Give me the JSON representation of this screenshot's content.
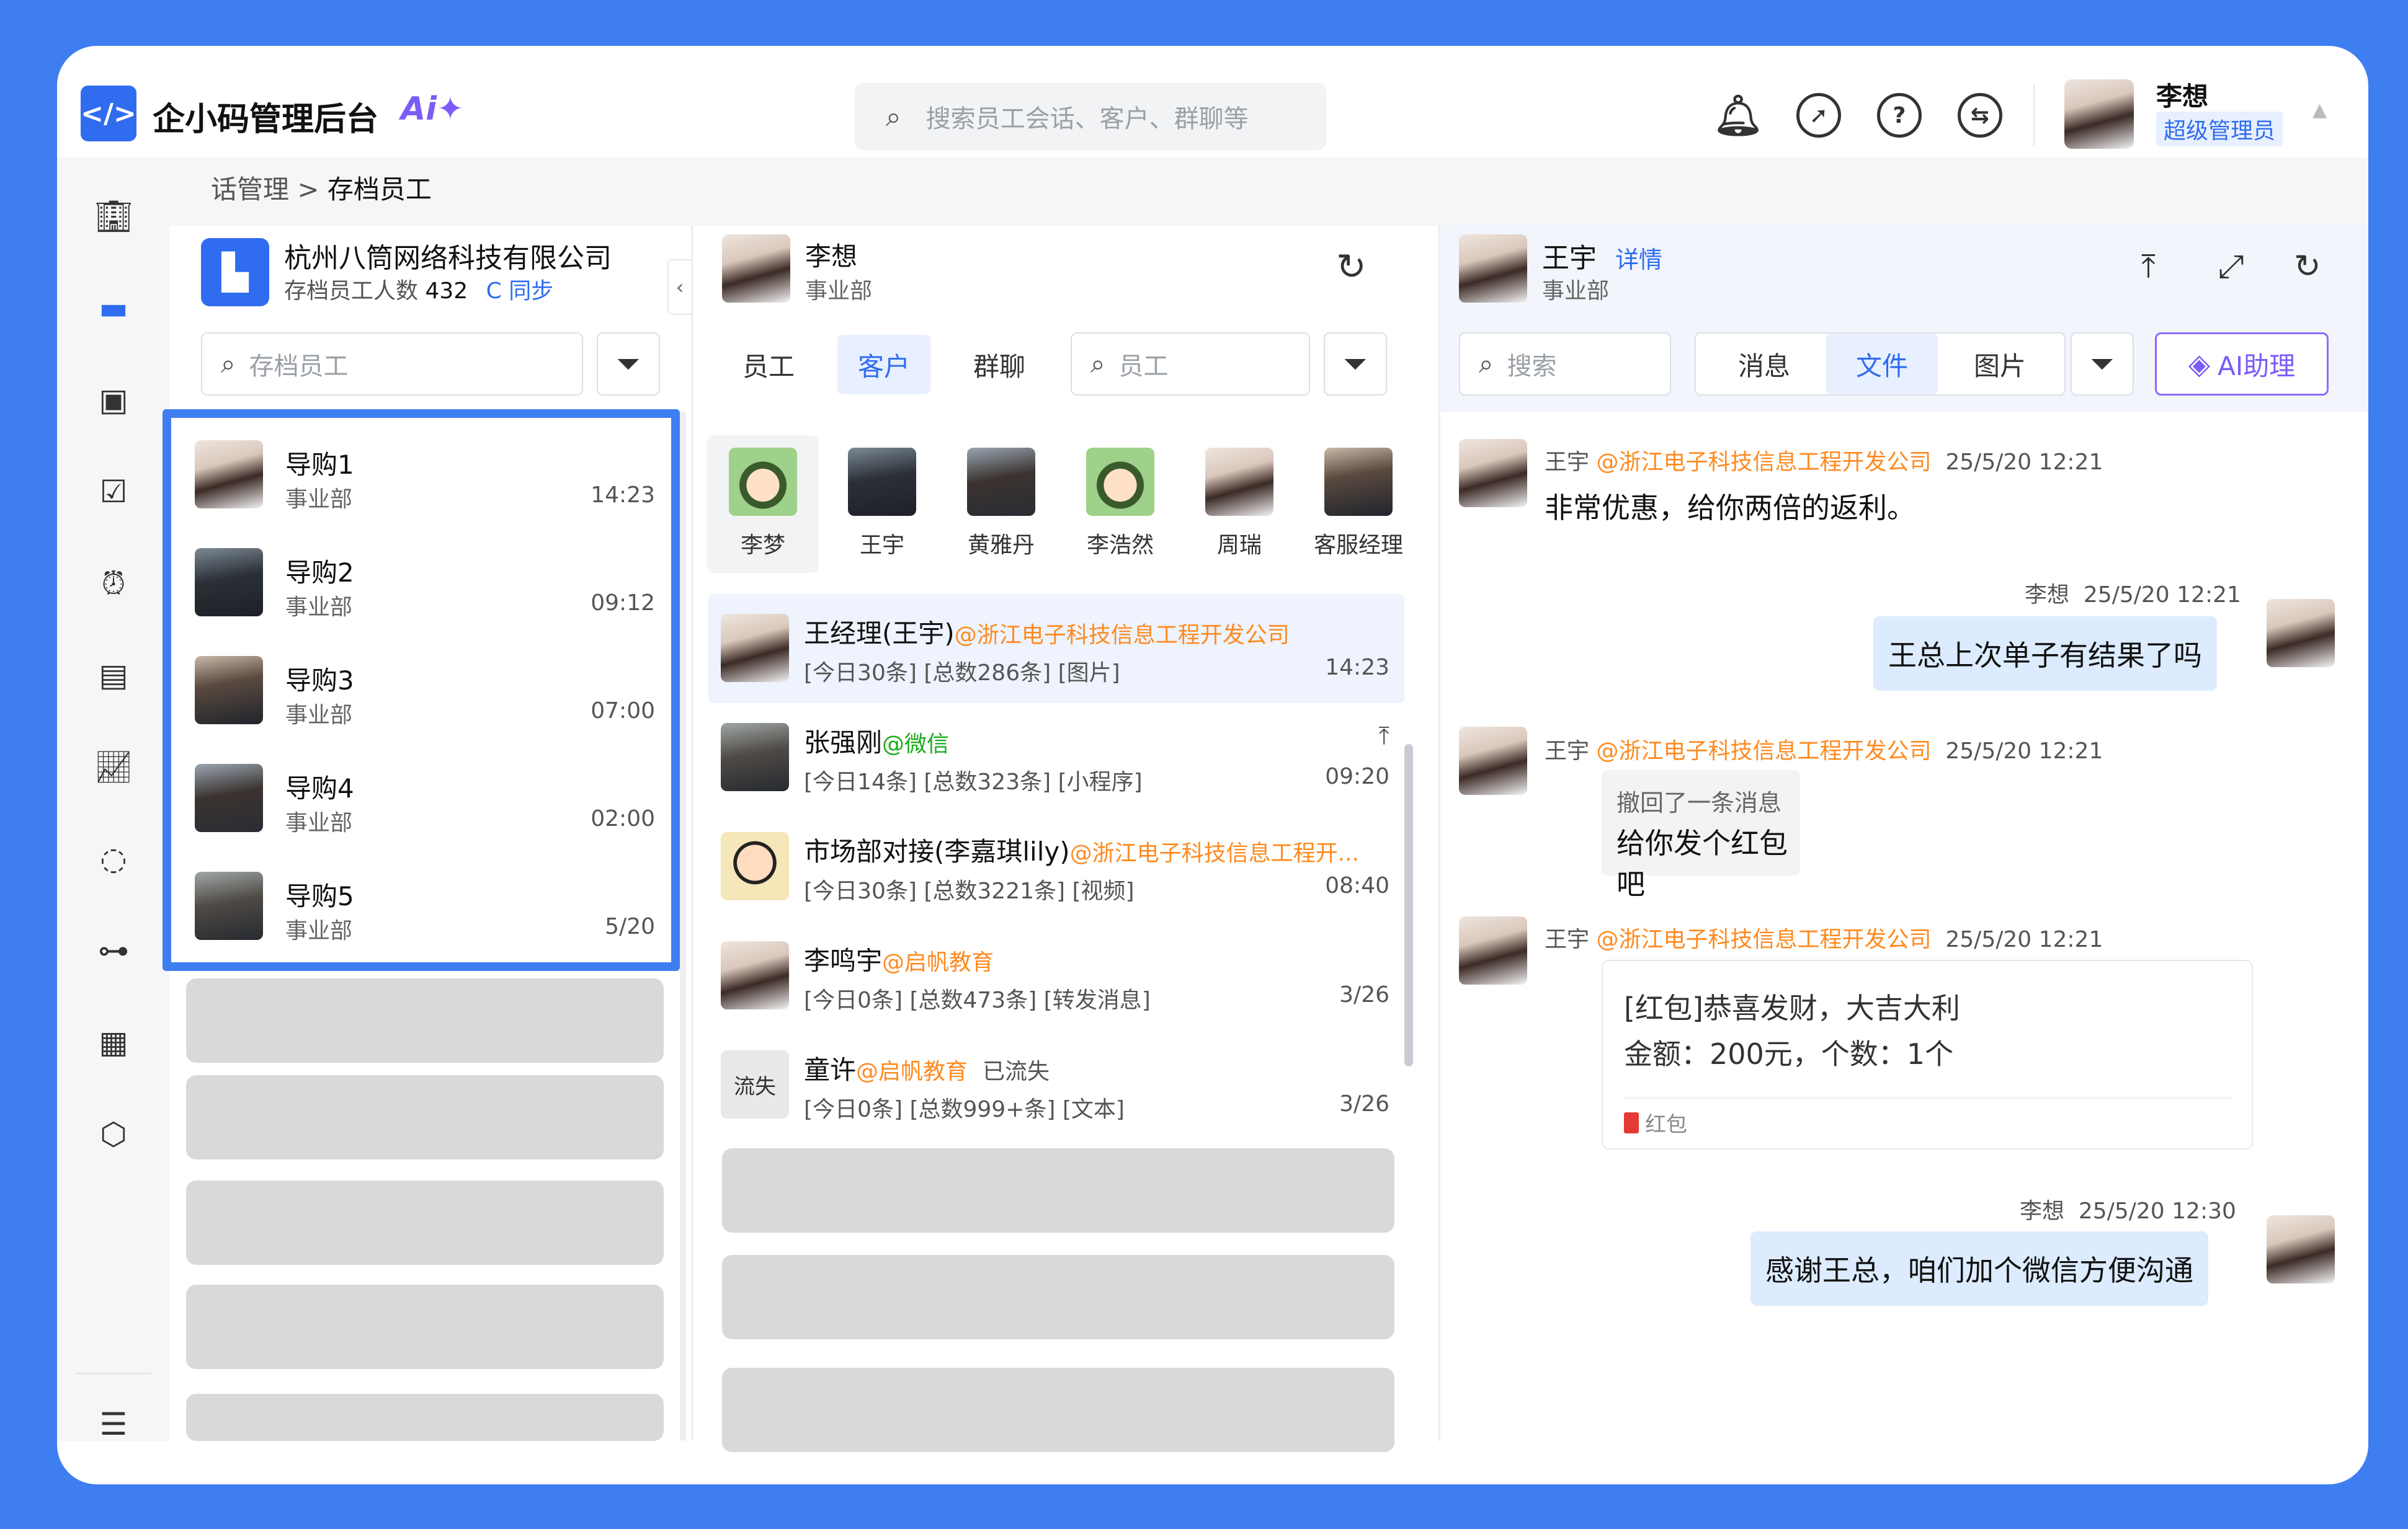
{
  "app": {
    "title": "企小码管理后台",
    "ai_mark": "Ai✦",
    "logo_glyph": "</>"
  },
  "search": {
    "placeholder": "搜索员工会话、客户、群聊等"
  },
  "user": {
    "name": "李想",
    "role": "超级管理员"
  },
  "breadcrumb": {
    "parent": "话管理",
    "current": "存档员工"
  },
  "org": {
    "name": "杭州八筒网络科技有限公司",
    "count_label": "存档员工人数",
    "count": "432",
    "sync": "C 同步"
  },
  "panel1": {
    "search_placeholder": "存档员工"
  },
  "employees": [
    {
      "name": "导购1",
      "dept": "事业部",
      "time": "14:23"
    },
    {
      "name": "导购2",
      "dept": "事业部",
      "time": "09:12"
    },
    {
      "name": "导购3",
      "dept": "事业部",
      "time": "07:00"
    },
    {
      "name": "导购4",
      "dept": "事业部",
      "time": "02:00"
    },
    {
      "name": "导购5",
      "dept": "事业部",
      "time": "5/20"
    }
  ],
  "panel2": {
    "name": "李想",
    "dept": "事业部",
    "tabs": [
      "员工",
      "客户",
      "群聊"
    ],
    "search_placeholder": "员工"
  },
  "customers": [
    "李梦",
    "王宇",
    "黄雅丹",
    "李浩然",
    "周瑞",
    "客服经理"
  ],
  "conversations": [
    {
      "name": "王经理(王宇)",
      "org": "@浙江电子科技信息工程开发公司",
      "summary": "[今日30条] [总数286条] [图片]",
      "time": "14:23"
    },
    {
      "name": "张强刚",
      "org": "@微信",
      "summary": "[今日14条] [总数323条] [小程序]",
      "time": "09:20"
    },
    {
      "name": "市场部对接(李嘉琪lily)",
      "org": "@浙江电子科技信息工程开...",
      "summary": "[今日30条] [总数3221条] [视频]",
      "time": "08:40"
    },
    {
      "name": "李鸣宇",
      "org": "@启帆教育",
      "summary": "[今日0条] [总数473条] [转发消息]",
      "time": "3/26"
    },
    {
      "name": "童许",
      "org": "@启帆教育",
      "status": "已流失",
      "summary": "[今日0条] [总数999+条] [文本]",
      "time": "3/26",
      "avatar_text": "流失"
    }
  ],
  "panel3": {
    "name": "王宇",
    "detail": "详情",
    "dept": "事业部",
    "search_placeholder": "搜索",
    "tabs": [
      "消息",
      "文件",
      "图片"
    ],
    "ai_button": "AI助理"
  },
  "messages": [
    {
      "sender": "王宇",
      "org": "@浙江电子科技信息工程开发公司",
      "time": "25/5/20 12:21",
      "text": "非常优惠，给你两倍的返利。"
    },
    {
      "sender": "李想",
      "time": "25/5/20 12:21",
      "text": "王总上次单子有结果了吗"
    },
    {
      "sender": "王宇",
      "org": "@浙江电子科技信息工程开发公司",
      "time": "25/5/20 12:21",
      "recall_note": "撤回了一条消息",
      "text": "给你发个红包吧"
    },
    {
      "sender": "王宇",
      "org": "@浙江电子科技信息工程开发公司",
      "time": "25/5/20 12:21",
      "card_line1": "[红包]恭喜发财，大吉大利",
      "card_line2": "金额：200元，个数：1个",
      "card_tag": "红包"
    },
    {
      "sender": "李想",
      "time": "25/5/20 12:30",
      "text": "感谢王总，咱们加个微信方便沟通"
    }
  ],
  "colors": {
    "accent": "#2f6cf0",
    "frame": "#3f7ef0",
    "org_tag": "#ff8a1f",
    "wechat": "#1aad19",
    "ai": "#7b5cf6",
    "bubble": "#dcebfd"
  }
}
